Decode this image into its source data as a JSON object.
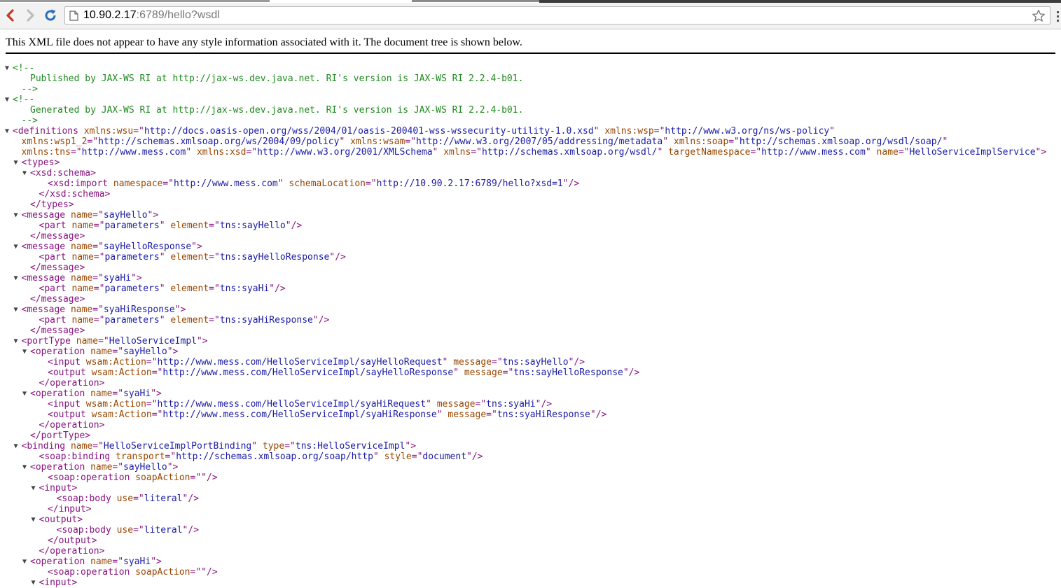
{
  "browser": {
    "url_host": "10.90.2.17",
    "url_rest": ":6789/hello?wsdl"
  },
  "info_text": "This XML file does not appear to have any style information associated with it. The document tree is shown below.",
  "xml_lines": [
    {
      "toggle": true,
      "depth": 0,
      "parts": [
        [
          "c",
          "<!--"
        ]
      ]
    },
    {
      "toggle": false,
      "depth": 2,
      "parts": [
        [
          "c",
          "Published by JAX-WS RI at http://jax-ws.dev.java.net. RI's version is JAX-WS RI 2.2.4-b01."
        ]
      ]
    },
    {
      "toggle": false,
      "depth": 1,
      "parts": [
        [
          "c",
          "-->"
        ]
      ]
    },
    {
      "toggle": true,
      "depth": 0,
      "parts": [
        [
          "c",
          "<!--"
        ]
      ]
    },
    {
      "toggle": false,
      "depth": 2,
      "parts": [
        [
          "c",
          "Generated by JAX-WS RI at http://jax-ws.dev.java.net. RI's version is JAX-WS RI 2.2.4-b01."
        ]
      ]
    },
    {
      "toggle": false,
      "depth": 1,
      "parts": [
        [
          "c",
          "-->"
        ]
      ]
    },
    {
      "toggle": true,
      "depth": 0,
      "parts": [
        [
          "t",
          "<definitions"
        ],
        [
          "t",
          " "
        ],
        [
          "a",
          "xmlns:wsu"
        ],
        [
          "t",
          "=\""
        ],
        [
          "v",
          "http://docs.oasis-open.org/wss/2004/01/oasis-200401-wss-wssecurity-utility-1.0.xsd"
        ],
        [
          "t",
          "\" "
        ],
        [
          "a",
          "xmlns:wsp"
        ],
        [
          "t",
          "=\""
        ],
        [
          "v",
          "http://www.w3.org/ns/ws-policy"
        ],
        [
          "t",
          "\""
        ]
      ]
    },
    {
      "toggle": false,
      "depth": 1,
      "parts": [
        [
          "a",
          "xmlns:wsp1_2"
        ],
        [
          "t",
          "=\""
        ],
        [
          "v",
          "http://schemas.xmlsoap.org/ws/2004/09/policy"
        ],
        [
          "t",
          "\" "
        ],
        [
          "a",
          "xmlns:wsam"
        ],
        [
          "t",
          "=\""
        ],
        [
          "v",
          "http://www.w3.org/2007/05/addressing/metadata"
        ],
        [
          "t",
          "\" "
        ],
        [
          "a",
          "xmlns:soap"
        ],
        [
          "t",
          "=\""
        ],
        [
          "v",
          "http://schemas.xmlsoap.org/wsdl/soap/"
        ],
        [
          "t",
          "\""
        ]
      ]
    },
    {
      "toggle": false,
      "depth": 1,
      "parts": [
        [
          "a",
          "xmlns:tns"
        ],
        [
          "t",
          "=\""
        ],
        [
          "v",
          "http://www.mess.com"
        ],
        [
          "t",
          "\" "
        ],
        [
          "a",
          "xmlns:xsd"
        ],
        [
          "t",
          "=\""
        ],
        [
          "v",
          "http://www.w3.org/2001/XMLSchema"
        ],
        [
          "t",
          "\" "
        ],
        [
          "a",
          "xmlns"
        ],
        [
          "t",
          "=\""
        ],
        [
          "v",
          "http://schemas.xmlsoap.org/wsdl/"
        ],
        [
          "t",
          "\" "
        ],
        [
          "a",
          "targetNamespace"
        ],
        [
          "t",
          "=\""
        ],
        [
          "v",
          "http://www.mess.com"
        ],
        [
          "t",
          "\" "
        ],
        [
          "a",
          "name"
        ],
        [
          "t",
          "=\""
        ],
        [
          "v",
          "HelloServiceImplService"
        ],
        [
          "t",
          "\">"
        ]
      ]
    },
    {
      "toggle": true,
      "depth": 1,
      "parts": [
        [
          "t",
          "<types>"
        ]
      ]
    },
    {
      "toggle": true,
      "depth": 2,
      "parts": [
        [
          "t",
          "<xsd:schema>"
        ]
      ]
    },
    {
      "toggle": false,
      "depth": 4,
      "parts": [
        [
          "t",
          "<xsd:import"
        ],
        [
          "t",
          " "
        ],
        [
          "a",
          "namespace"
        ],
        [
          "t",
          "=\""
        ],
        [
          "v",
          "http://www.mess.com"
        ],
        [
          "t",
          "\" "
        ],
        [
          "a",
          "schemaLocation"
        ],
        [
          "t",
          "=\""
        ],
        [
          "v",
          "http://10.90.2.17:6789/hello?xsd=1"
        ],
        [
          "t",
          "\"/>"
        ]
      ]
    },
    {
      "toggle": false,
      "depth": 3,
      "parts": [
        [
          "t",
          "</xsd:schema>"
        ]
      ]
    },
    {
      "toggle": false,
      "depth": 2,
      "parts": [
        [
          "t",
          "</types>"
        ]
      ]
    },
    {
      "toggle": true,
      "depth": 1,
      "parts": [
        [
          "t",
          "<message"
        ],
        [
          "t",
          " "
        ],
        [
          "a",
          "name"
        ],
        [
          "t",
          "=\""
        ],
        [
          "v",
          "sayHello"
        ],
        [
          "t",
          "\">"
        ]
      ]
    },
    {
      "toggle": false,
      "depth": 3,
      "parts": [
        [
          "t",
          "<part"
        ],
        [
          "t",
          " "
        ],
        [
          "a",
          "name"
        ],
        [
          "t",
          "=\""
        ],
        [
          "v",
          "parameters"
        ],
        [
          "t",
          "\" "
        ],
        [
          "a",
          "element"
        ],
        [
          "t",
          "=\""
        ],
        [
          "v",
          "tns:sayHello"
        ],
        [
          "t",
          "\"/>"
        ]
      ]
    },
    {
      "toggle": false,
      "depth": 2,
      "parts": [
        [
          "t",
          "</message>"
        ]
      ]
    },
    {
      "toggle": true,
      "depth": 1,
      "parts": [
        [
          "t",
          "<message"
        ],
        [
          "t",
          " "
        ],
        [
          "a",
          "name"
        ],
        [
          "t",
          "=\""
        ],
        [
          "v",
          "sayHelloResponse"
        ],
        [
          "t",
          "\">"
        ]
      ]
    },
    {
      "toggle": false,
      "depth": 3,
      "parts": [
        [
          "t",
          "<part"
        ],
        [
          "t",
          " "
        ],
        [
          "a",
          "name"
        ],
        [
          "t",
          "=\""
        ],
        [
          "v",
          "parameters"
        ],
        [
          "t",
          "\" "
        ],
        [
          "a",
          "element"
        ],
        [
          "t",
          "=\""
        ],
        [
          "v",
          "tns:sayHelloResponse"
        ],
        [
          "t",
          "\"/>"
        ]
      ]
    },
    {
      "toggle": false,
      "depth": 2,
      "parts": [
        [
          "t",
          "</message>"
        ]
      ]
    },
    {
      "toggle": true,
      "depth": 1,
      "parts": [
        [
          "t",
          "<message"
        ],
        [
          "t",
          " "
        ],
        [
          "a",
          "name"
        ],
        [
          "t",
          "=\""
        ],
        [
          "v",
          "syaHi"
        ],
        [
          "t",
          "\">"
        ]
      ]
    },
    {
      "toggle": false,
      "depth": 3,
      "parts": [
        [
          "t",
          "<part"
        ],
        [
          "t",
          " "
        ],
        [
          "a",
          "name"
        ],
        [
          "t",
          "=\""
        ],
        [
          "v",
          "parameters"
        ],
        [
          "t",
          "\" "
        ],
        [
          "a",
          "element"
        ],
        [
          "t",
          "=\""
        ],
        [
          "v",
          "tns:syaHi"
        ],
        [
          "t",
          "\"/>"
        ]
      ]
    },
    {
      "toggle": false,
      "depth": 2,
      "parts": [
        [
          "t",
          "</message>"
        ]
      ]
    },
    {
      "toggle": true,
      "depth": 1,
      "parts": [
        [
          "t",
          "<message"
        ],
        [
          "t",
          " "
        ],
        [
          "a",
          "name"
        ],
        [
          "t",
          "=\""
        ],
        [
          "v",
          "syaHiResponse"
        ],
        [
          "t",
          "\">"
        ]
      ]
    },
    {
      "toggle": false,
      "depth": 3,
      "parts": [
        [
          "t",
          "<part"
        ],
        [
          "t",
          " "
        ],
        [
          "a",
          "name"
        ],
        [
          "t",
          "=\""
        ],
        [
          "v",
          "parameters"
        ],
        [
          "t",
          "\" "
        ],
        [
          "a",
          "element"
        ],
        [
          "t",
          "=\""
        ],
        [
          "v",
          "tns:syaHiResponse"
        ],
        [
          "t",
          "\"/>"
        ]
      ]
    },
    {
      "toggle": false,
      "depth": 2,
      "parts": [
        [
          "t",
          "</message>"
        ]
      ]
    },
    {
      "toggle": true,
      "depth": 1,
      "parts": [
        [
          "t",
          "<portType"
        ],
        [
          "t",
          " "
        ],
        [
          "a",
          "name"
        ],
        [
          "t",
          "=\""
        ],
        [
          "v",
          "HelloServiceImpl"
        ],
        [
          "t",
          "\">"
        ]
      ]
    },
    {
      "toggle": true,
      "depth": 2,
      "parts": [
        [
          "t",
          "<operation"
        ],
        [
          "t",
          " "
        ],
        [
          "a",
          "name"
        ],
        [
          "t",
          "=\""
        ],
        [
          "v",
          "sayHello"
        ],
        [
          "t",
          "\">"
        ]
      ]
    },
    {
      "toggle": false,
      "depth": 4,
      "parts": [
        [
          "t",
          "<input"
        ],
        [
          "t",
          " "
        ],
        [
          "a",
          "wsam:Action"
        ],
        [
          "t",
          "=\""
        ],
        [
          "v",
          "http://www.mess.com/HelloServiceImpl/sayHelloRequest"
        ],
        [
          "t",
          "\" "
        ],
        [
          "a",
          "message"
        ],
        [
          "t",
          "=\""
        ],
        [
          "v",
          "tns:sayHello"
        ],
        [
          "t",
          "\"/>"
        ]
      ]
    },
    {
      "toggle": false,
      "depth": 4,
      "parts": [
        [
          "t",
          "<output"
        ],
        [
          "t",
          " "
        ],
        [
          "a",
          "wsam:Action"
        ],
        [
          "t",
          "=\""
        ],
        [
          "v",
          "http://www.mess.com/HelloServiceImpl/sayHelloResponse"
        ],
        [
          "t",
          "\" "
        ],
        [
          "a",
          "message"
        ],
        [
          "t",
          "=\""
        ],
        [
          "v",
          "tns:sayHelloResponse"
        ],
        [
          "t",
          "\"/>"
        ]
      ]
    },
    {
      "toggle": false,
      "depth": 3,
      "parts": [
        [
          "t",
          "</operation>"
        ]
      ]
    },
    {
      "toggle": true,
      "depth": 2,
      "parts": [
        [
          "t",
          "<operation"
        ],
        [
          "t",
          " "
        ],
        [
          "a",
          "name"
        ],
        [
          "t",
          "=\""
        ],
        [
          "v",
          "syaHi"
        ],
        [
          "t",
          "\">"
        ]
      ]
    },
    {
      "toggle": false,
      "depth": 4,
      "parts": [
        [
          "t",
          "<input"
        ],
        [
          "t",
          " "
        ],
        [
          "a",
          "wsam:Action"
        ],
        [
          "t",
          "=\""
        ],
        [
          "v",
          "http://www.mess.com/HelloServiceImpl/syaHiRequest"
        ],
        [
          "t",
          "\" "
        ],
        [
          "a",
          "message"
        ],
        [
          "t",
          "=\""
        ],
        [
          "v",
          "tns:syaHi"
        ],
        [
          "t",
          "\"/>"
        ]
      ]
    },
    {
      "toggle": false,
      "depth": 4,
      "parts": [
        [
          "t",
          "<output"
        ],
        [
          "t",
          " "
        ],
        [
          "a",
          "wsam:Action"
        ],
        [
          "t",
          "=\""
        ],
        [
          "v",
          "http://www.mess.com/HelloServiceImpl/syaHiResponse"
        ],
        [
          "t",
          "\" "
        ],
        [
          "a",
          "message"
        ],
        [
          "t",
          "=\""
        ],
        [
          "v",
          "tns:syaHiResponse"
        ],
        [
          "t",
          "\"/>"
        ]
      ]
    },
    {
      "toggle": false,
      "depth": 3,
      "parts": [
        [
          "t",
          "</operation>"
        ]
      ]
    },
    {
      "toggle": false,
      "depth": 2,
      "parts": [
        [
          "t",
          "</portType>"
        ]
      ]
    },
    {
      "toggle": true,
      "depth": 1,
      "parts": [
        [
          "t",
          "<binding"
        ],
        [
          "t",
          " "
        ],
        [
          "a",
          "name"
        ],
        [
          "t",
          "=\""
        ],
        [
          "v",
          "HelloServiceImplPortBinding"
        ],
        [
          "t",
          "\" "
        ],
        [
          "a",
          "type"
        ],
        [
          "t",
          "=\""
        ],
        [
          "v",
          "tns:HelloServiceImpl"
        ],
        [
          "t",
          "\">"
        ]
      ]
    },
    {
      "toggle": false,
      "depth": 3,
      "parts": [
        [
          "t",
          "<soap:binding"
        ],
        [
          "t",
          " "
        ],
        [
          "a",
          "transport"
        ],
        [
          "t",
          "=\""
        ],
        [
          "v",
          "http://schemas.xmlsoap.org/soap/http"
        ],
        [
          "t",
          "\" "
        ],
        [
          "a",
          "style"
        ],
        [
          "t",
          "=\""
        ],
        [
          "v",
          "document"
        ],
        [
          "t",
          "\"/>"
        ]
      ]
    },
    {
      "toggle": true,
      "depth": 2,
      "parts": [
        [
          "t",
          "<operation"
        ],
        [
          "t",
          " "
        ],
        [
          "a",
          "name"
        ],
        [
          "t",
          "=\""
        ],
        [
          "v",
          "sayHello"
        ],
        [
          "t",
          "\">"
        ]
      ]
    },
    {
      "toggle": false,
      "depth": 4,
      "parts": [
        [
          "t",
          "<soap:operation"
        ],
        [
          "t",
          " "
        ],
        [
          "a",
          "soapAction"
        ],
        [
          "t",
          "=\""
        ],
        [
          "v",
          ""
        ],
        [
          "t",
          "\"/>"
        ]
      ]
    },
    {
      "toggle": true,
      "depth": 3,
      "parts": [
        [
          "t",
          "<input>"
        ]
      ]
    },
    {
      "toggle": false,
      "depth": 5,
      "parts": [
        [
          "t",
          "<soap:body"
        ],
        [
          "t",
          " "
        ],
        [
          "a",
          "use"
        ],
        [
          "t",
          "=\""
        ],
        [
          "v",
          "literal"
        ],
        [
          "t",
          "\"/>"
        ]
      ]
    },
    {
      "toggle": false,
      "depth": 4,
      "parts": [
        [
          "t",
          "</input>"
        ]
      ]
    },
    {
      "toggle": true,
      "depth": 3,
      "parts": [
        [
          "t",
          "<output>"
        ]
      ]
    },
    {
      "toggle": false,
      "depth": 5,
      "parts": [
        [
          "t",
          "<soap:body"
        ],
        [
          "t",
          " "
        ],
        [
          "a",
          "use"
        ],
        [
          "t",
          "=\""
        ],
        [
          "v",
          "literal"
        ],
        [
          "t",
          "\"/>"
        ]
      ]
    },
    {
      "toggle": false,
      "depth": 4,
      "parts": [
        [
          "t",
          "</output>"
        ]
      ]
    },
    {
      "toggle": false,
      "depth": 3,
      "parts": [
        [
          "t",
          "</operation>"
        ]
      ]
    },
    {
      "toggle": true,
      "depth": 2,
      "parts": [
        [
          "t",
          "<operation"
        ],
        [
          "t",
          " "
        ],
        [
          "a",
          "name"
        ],
        [
          "t",
          "=\""
        ],
        [
          "v",
          "syaHi"
        ],
        [
          "t",
          "\">"
        ]
      ]
    },
    {
      "toggle": false,
      "depth": 4,
      "parts": [
        [
          "t",
          "<soap:operation"
        ],
        [
          "t",
          " "
        ],
        [
          "a",
          "soapAction"
        ],
        [
          "t",
          "=\""
        ],
        [
          "v",
          ""
        ],
        [
          "t",
          "\"/>"
        ]
      ]
    },
    {
      "toggle": true,
      "depth": 3,
      "parts": [
        [
          "t",
          "<input>"
        ]
      ]
    }
  ]
}
